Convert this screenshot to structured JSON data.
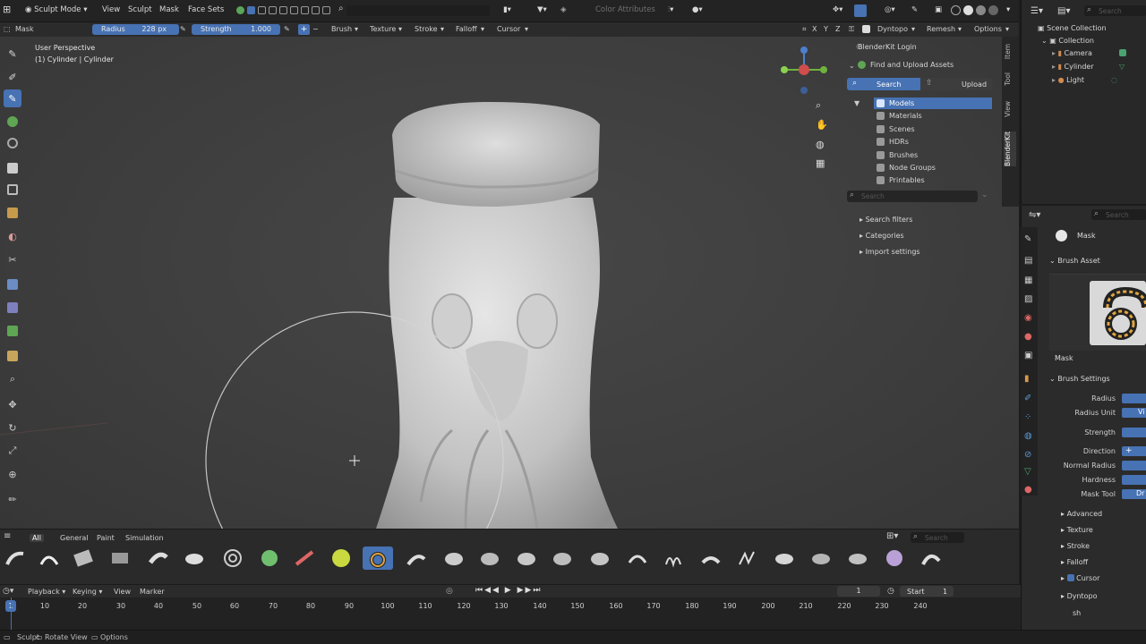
{
  "topbar": {
    "mode": "Sculpt Mode",
    "menus": [
      "View",
      "Sculpt",
      "Mask",
      "Face Sets"
    ],
    "color_attributes": "Color Attributes",
    "axes": [
      "X",
      "Y",
      "Z"
    ],
    "dyntopo": "Dyntopo",
    "remesh": "Remesh",
    "options": "Options"
  },
  "tool_header": {
    "tool_name": "Mask",
    "radius_label": "Radius",
    "radius_value": "228 px",
    "strength_label": "Strength",
    "strength_value": "1.000",
    "menus": [
      "Brush",
      "Texture",
      "Stroke",
      "Falloff",
      "Cursor"
    ]
  },
  "viewport": {
    "view_name": "User Perspective",
    "object_name": "(1) Cylinder | Cylinder"
  },
  "blenderkit": {
    "login": "BlenderKit Login",
    "find_upload": "Find and Upload Assets",
    "search_tab": "Search",
    "upload_tab": "Upload",
    "asset_types": [
      "Models",
      "Materials",
      "Scenes",
      "HDRs",
      "Brushes",
      "Node Groups",
      "Printables"
    ],
    "search_placeholder": "Search",
    "sections": [
      "Search filters",
      "Categories",
      "Import settings"
    ]
  },
  "sidebar_tabs": [
    "Item",
    "Tool",
    "View",
    "BlenderKit"
  ],
  "outliner": {
    "search_placeholder": "Search",
    "scene_collection": "Scene Collection",
    "collection": "Collection",
    "objects": [
      "Camera",
      "Cylinder",
      "Light"
    ]
  },
  "properties": {
    "search_placeholder": "Search",
    "brush_name": "Mask",
    "brush_asset_header": "Brush Asset",
    "brush_asset_name": "Mask",
    "brush_settings_header": "Brush Settings",
    "labels": [
      "Radius",
      "Radius Unit",
      "Strength",
      "Direction",
      "Normal Radius",
      "Hardness",
      "Mask Tool"
    ],
    "radius_unit_value": "Vi",
    "direction_value": "+",
    "mask_tool_value": "Dr",
    "sections": [
      "Advanced",
      "Texture",
      "Stroke",
      "Falloff"
    ],
    "cursor_label": "Cursor",
    "dyntopo_label": "Dyntopo",
    "partial_label": "sh"
  },
  "brush_shelf": {
    "tabs": [
      "All",
      "General",
      "Paint",
      "Simulation"
    ],
    "search_placeholder": "Search"
  },
  "timeline": {
    "menus": [
      "Playback",
      "Keying",
      "View",
      "Marker"
    ],
    "current_frame": "1",
    "start_label": "Start",
    "start_value": "1",
    "ticks": [
      "1",
      "10",
      "20",
      "30",
      "40",
      "50",
      "60",
      "70",
      "80",
      "90",
      "100",
      "110",
      "120",
      "130",
      "140",
      "150",
      "160",
      "170",
      "180",
      "190",
      "200",
      "210",
      "220",
      "230",
      "240"
    ]
  },
  "statusbar": {
    "items": [
      "Sculpt",
      "Rotate View",
      "Options"
    ]
  },
  "colors": {
    "accent": "#4772b3",
    "panel": "#2b2b2b",
    "viewport": "#3e3e3e"
  }
}
